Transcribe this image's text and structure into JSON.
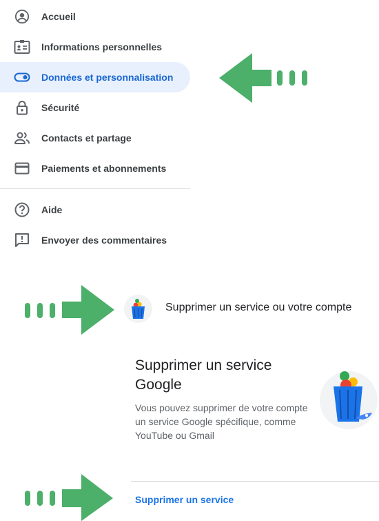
{
  "nav": {
    "items": [
      {
        "label": "Accueil",
        "icon": "account-circle-icon"
      },
      {
        "label": "Informations personnelles",
        "icon": "id-card-icon"
      },
      {
        "label": "Données et personnalisation",
        "icon": "toggle-icon",
        "active": true
      },
      {
        "label": "Sécurité",
        "icon": "lock-icon"
      },
      {
        "label": "Contacts et partage",
        "icon": "people-icon"
      },
      {
        "label": "Paiements et abonnements",
        "icon": "credit-card-icon"
      }
    ],
    "secondary": [
      {
        "label": "Aide",
        "icon": "help-icon"
      },
      {
        "label": "Envoyer des commentaires",
        "icon": "feedback-icon"
      }
    ]
  },
  "delete_row": {
    "label": "Supprimer un service ou votre compte",
    "icon": "trash-bin-icon"
  },
  "card": {
    "title": "Supprimer un service Google",
    "description": "Vous pouvez supprimer de votre compte un service Google spécifique, comme YouTube ou Gmail",
    "link": "Supprimer un service",
    "illustration": "trash-bin-illustration"
  },
  "colors": {
    "accent": "#1a73e8",
    "active_bg": "#e8f0fe",
    "annotation_arrow": "#4caf6a"
  }
}
